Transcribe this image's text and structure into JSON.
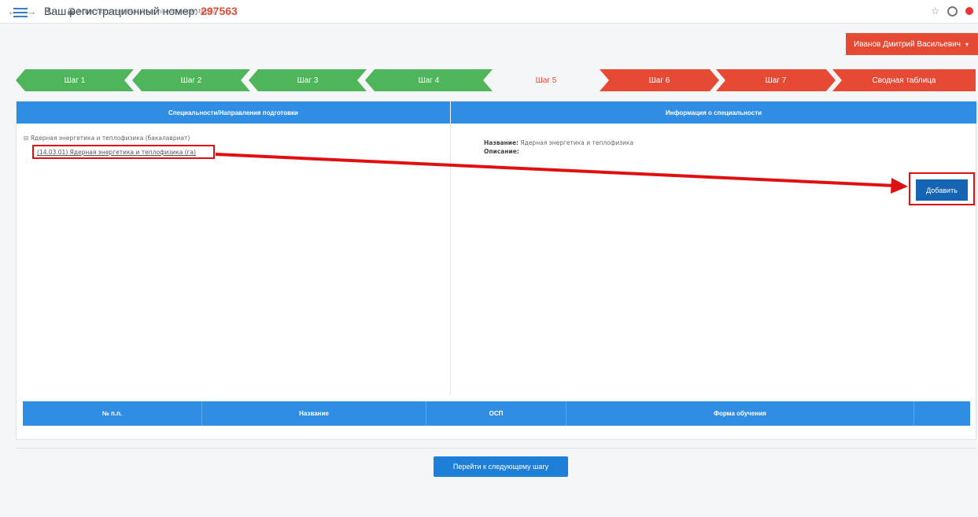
{
  "browser": {
    "url": "https://org.mephi.ru/mephi-entrance/step5/"
  },
  "header": {
    "reg_label": "Ваш регистрационный номер:",
    "reg_number": "297563",
    "user_name": "Иванов Дмитрий Васильевич"
  },
  "steps": [
    {
      "label": "Шаг 1",
      "state": "done"
    },
    {
      "label": "Шаг 2",
      "state": "done"
    },
    {
      "label": "Шаг 3",
      "state": "done"
    },
    {
      "label": "Шаг 4",
      "state": "done"
    },
    {
      "label": "Шаг 5",
      "state": "current"
    },
    {
      "label": "Шаг 6",
      "state": "todo"
    },
    {
      "label": "Шаг 7",
      "state": "todo"
    },
    {
      "label": "Сводная таблица",
      "state": "todo"
    }
  ],
  "left_panel": {
    "title": "Специальности/Направления подготовки",
    "tree_root": "Ядерная энергетика и теплофизика (бакалавриат)",
    "tree_item": "(14.03.01) Ядерная энергетика и теплофизика (га)"
  },
  "right_panel": {
    "title": "Информация о специальности",
    "name_label": "Название:",
    "name_value": "Ядерная энергетика и теплофизика",
    "desc_label": "Описание:",
    "add_button": "Добавить"
  },
  "table": {
    "columns": [
      "№ п.п.",
      "Название",
      "ОСП",
      "Форма обучения",
      ""
    ]
  },
  "footer": {
    "next_button": "Перейти к следующему шагу"
  },
  "colors": {
    "done": "#4fb55a",
    "todo": "#e64a34",
    "header_blue": "#2f8de4",
    "annotation_red": "#e01010"
  }
}
